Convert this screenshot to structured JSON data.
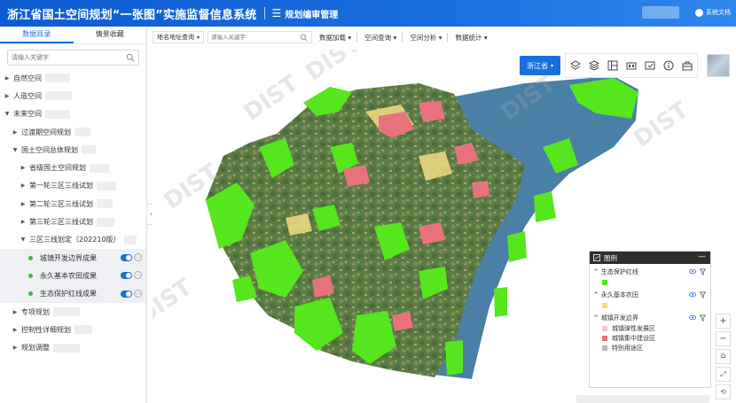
{
  "header": {
    "app_title": "浙江省国土空间规划“一张图”实施监督信息系统",
    "module_title": "规划编审管理",
    "doc_label": "系统文档"
  },
  "sidebar": {
    "tabs": [
      {
        "label": "数据目录",
        "active": true
      },
      {
        "label": "情景收藏",
        "active": false
      }
    ],
    "search_placeholder": "请输入关键字",
    "tree": [
      {
        "label": "自然空间",
        "level": 0,
        "caret": "right"
      },
      {
        "label": "人造空间",
        "level": 0,
        "caret": "right"
      },
      {
        "label": "未来空间",
        "level": 0,
        "caret": "down"
      },
      {
        "label": "过渡期空间规划",
        "level": 1,
        "caret": "right"
      },
      {
        "label": "国土空间总体规划",
        "level": 1,
        "caret": "down"
      },
      {
        "label": "省级国土空间规划",
        "level": 2,
        "caret": "right"
      },
      {
        "label": "第一轮三区三线试划",
        "level": 2,
        "caret": "right"
      },
      {
        "label": "第二轮三区三线试划",
        "level": 2,
        "caret": "right"
      },
      {
        "label": "第三轮三区三线试划",
        "level": 2,
        "caret": "right"
      },
      {
        "label": "三区三线划定（202210版）",
        "level": 2,
        "caret": "down"
      },
      {
        "label": "城镇开发边界成果",
        "level": 3,
        "layer": true
      },
      {
        "label": "永久基本农田成果",
        "level": 3,
        "layer": true
      },
      {
        "label": "生态保护红线成果",
        "level": 3,
        "layer": true
      },
      {
        "label": "专项规划",
        "level": 1,
        "caret": "right"
      },
      {
        "label": "控制性详细规划",
        "level": 1,
        "caret": "right"
      },
      {
        "label": "规划调整",
        "level": 1,
        "caret": "right"
      }
    ]
  },
  "toolbar": {
    "location_select": "地名地址查询",
    "search_placeholder": "请输入关键字",
    "menus": [
      "数据加载",
      "空间查询",
      "空间分析",
      "数据统计"
    ]
  },
  "map": {
    "region_button": "浙江省",
    "tools": [
      "layers-icon",
      "layer-stack-icon",
      "layout-icon",
      "compare-icon",
      "screen-icon",
      "info-icon",
      "toolbox-icon"
    ],
    "watermark": "DIST"
  },
  "legend": {
    "title": "图例",
    "groups": [
      {
        "label": "生态保护红线",
        "items": [
          {
            "label": "",
            "color": "#55e61e"
          }
        ]
      },
      {
        "label": "永久基本农田",
        "items": [
          {
            "label": "",
            "color": "#f3dc82"
          }
        ]
      },
      {
        "label": "城镇开发边界",
        "items": [
          {
            "label": "城镇弹性发展区",
            "color": "#f6c4c4"
          },
          {
            "label": "城镇集中建设区",
            "color": "#e8737c"
          },
          {
            "label": "特别用途区",
            "color": "#b8b8b8"
          }
        ]
      }
    ]
  },
  "colors": {
    "brand": "#1a6fe0",
    "ecological": "#55e61e",
    "farmland": "#f3dc82",
    "urban": "#e8737c",
    "sea": "#4a7fa6"
  }
}
